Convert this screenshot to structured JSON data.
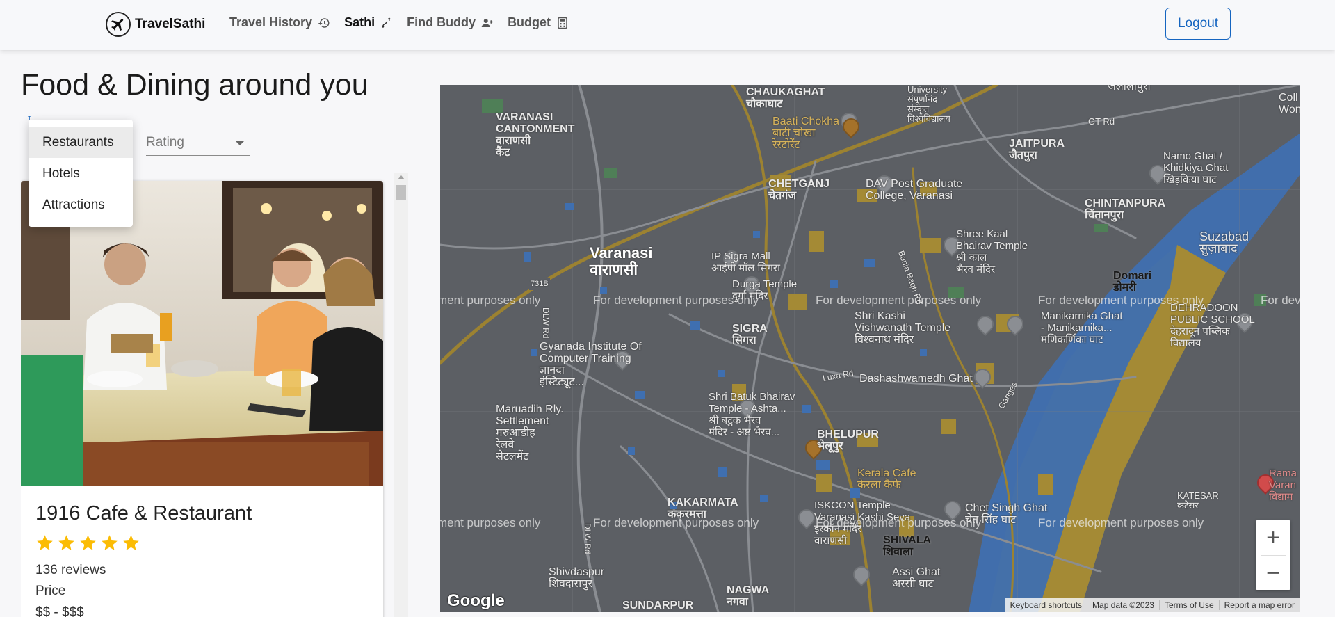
{
  "navbar": {
    "brand": "TravelSathi",
    "links": [
      {
        "label": "Travel History",
        "icon": "history-icon"
      },
      {
        "label": "Sathi",
        "icon": "route-icon"
      },
      {
        "label": "Find Buddy",
        "icon": "person-add-icon"
      },
      {
        "label": "Budget",
        "icon": "calculator-icon"
      }
    ],
    "logout": "Logout"
  },
  "page": {
    "title": "Food & Dining around you",
    "type_label": "T",
    "rating_placeholder": "Rating"
  },
  "type_menu": {
    "options": [
      "Restaurants",
      "Hotels",
      "Attractions"
    ],
    "selected": "Restaurants"
  },
  "places": [
    {
      "name": "1916 Cafe & Restaurant",
      "rating": 5,
      "reviews": "136 reviews",
      "price_label": "Price",
      "price_range": "$$ - $$$"
    }
  ],
  "map": {
    "labels": {
      "chaukaghat": "CHAUKAGHAT\nचौकाघाट",
      "cantonment": "VARANASI\nCANTONMENT\nवाराणसी\nकैंट",
      "baati": "Baati Chokha\nबाटी चोखा\nरेस्टोरेंट",
      "university": "University\nसंपूर्णानंद\nसंस्कृत\nविश्वविद्यालय",
      "jaitpura": "JAITPURA\nजैतपुरा",
      "gtrd": "GT Rd",
      "namo": "Namo Ghat /\nKhidkiya Ghat\nखिड़किया घाट",
      "chetganj": "CHETGANJ\nचेतगंज",
      "dav": "DAV Post Graduate\nCollege, Varanasi",
      "chintanpura": "CHINTANPURA\nचिंतानपुरा",
      "varanasi": "Varanasi\nवाराणसी",
      "sigramall": "IP Sigra Mall\nआईपी मॉल सिगरा",
      "durga": "Durga Temple\nदुर्गा मंदिर",
      "shreekaal": "Shree Kaal\nBhairav Temple\nश्री काल\nभैरव मंदिर",
      "suzabad": "Suzabad\nसुज़ाबाद",
      "domari": "Domari\nडोमरी",
      "sigra": "SIGRA\nसिगरा",
      "shrikashi": "Shri Kashi\nVishwanath Temple\nविश्वनाथ मंदिर",
      "manikarnika": "Manikarnika Ghat\n- Manikarnika...\nमणिकर्णिका घाट",
      "dehradoon": "DEHRADOON\nPUBLIC SCHOOL\nदेहरादून पब्लिक\nविद्यालय",
      "gyanada": "Gyanada Institute Of\nComputer Training\nज्ञानदा\nइंस्टिट्यूट...",
      "dashashwamedh": "Dashashwamedh Ghat",
      "batuk": "Shri Batuk Bhairav\nTemple - Ashta...\nश्री बटुक भैरव\nमंदिर - अष्ट भैरव...",
      "maruadih": "Maruadih Rly.\nSettlement\nमरुआडीह\nरेलवे\nसेटलमेंट",
      "bhelupur": "BHELUPUR\nभेलूपुर",
      "kerala": "Kerala Cafe\nकेरला कैफे",
      "kakarmata": "KAKARMATA\nककरमत्ता",
      "iskcon": "ISKCON Temple\nVaranasi Kashi Seva\nइस्कॉन मंदिर\nवाराणसी",
      "chetsingh": "Chet Singh Ghat\nचेत सिंह घाट",
      "katesar": "KATESAR\nकटेसर",
      "shivala": "SHIVALA\nशिवाला",
      "shivdaspur": "Shivdaspur\nशिवदासपुर",
      "assi": "Assi Ghat\nअस्सी घाट",
      "nagwa": "NAGWA\nनगवा",
      "sundarpur": "SUNDARPUR",
      "ramana": "Rama\nVaran\nविद्याम",
      "college": "Coll\nWome",
      "jalalipura": "जलालीपुरा",
      "dlw1": "DLW Rd",
      "dlw2": "DLW Rd",
      "luxa": "Luxa Rd",
      "benia": "Benia Bagh Rd",
      "ganges": "Ganges",
      "r731b": "731B"
    },
    "watermark": "For development purposes only",
    "zoom_in": "+",
    "zoom_out": "−",
    "google": "Google",
    "attribution": [
      "Keyboard shortcuts",
      "Map data ©2023",
      "Terms of Use",
      "Report a map error"
    ]
  },
  "colors": {
    "accent": "#1565c0",
    "star": "#fbbc04",
    "map_bg": "#5a5d62",
    "river": "#3f6fb0",
    "sand": "#a48a35"
  }
}
